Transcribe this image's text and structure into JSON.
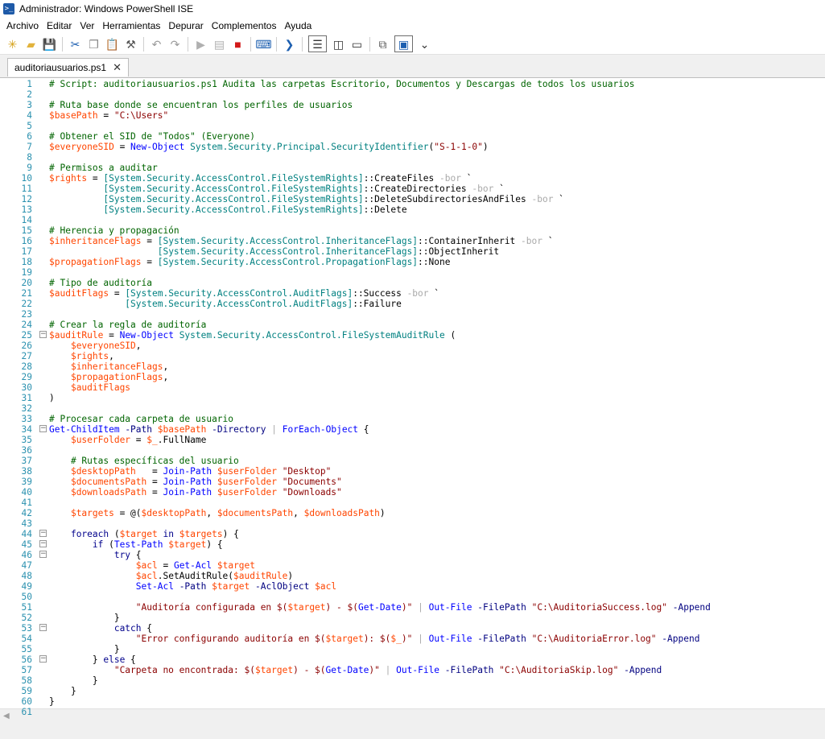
{
  "window": {
    "title": "Administrador: Windows PowerShell ISE"
  },
  "menu": [
    "Archivo",
    "Editar",
    "Ver",
    "Herramientas",
    "Depurar",
    "Complementos",
    "Ayuda"
  ],
  "toolbar": [
    {
      "name": "new-file-icon",
      "glyph": "✳",
      "color": "#d4a017"
    },
    {
      "name": "open-file-icon",
      "glyph": "▰",
      "color": "#e2b33c"
    },
    {
      "name": "save-icon",
      "glyph": "💾",
      "color": "#2a5bb7"
    },
    {
      "sep": true
    },
    {
      "name": "cut-icon",
      "glyph": "✂",
      "color": "#1d5fb0"
    },
    {
      "name": "copy-icon",
      "glyph": "❐",
      "color": "#888888"
    },
    {
      "name": "paste-icon",
      "glyph": "📋",
      "color": "#555555"
    },
    {
      "name": "clear-icon",
      "glyph": "⚒",
      "color": "#555555"
    },
    {
      "sep": true
    },
    {
      "name": "undo-icon",
      "glyph": "↶",
      "color": "#9a9a9a"
    },
    {
      "name": "redo-icon",
      "glyph": "↷",
      "color": "#9a9a9a"
    },
    {
      "sep": true
    },
    {
      "name": "run-icon",
      "glyph": "▶",
      "color": "#b0b0b0"
    },
    {
      "name": "run-selection-icon",
      "glyph": "▤",
      "color": "#b0b0b0"
    },
    {
      "name": "stop-icon",
      "glyph": "■",
      "color": "#d21a1a"
    },
    {
      "sep": true
    },
    {
      "name": "remote-powershell-icon",
      "glyph": "⌨",
      "color": "#1d5fb0"
    },
    {
      "sep": true
    },
    {
      "name": "powershell-console-icon",
      "glyph": "❯",
      "color": "#1d5fb0"
    },
    {
      "sep": true
    },
    {
      "name": "show-script-top-icon",
      "glyph": "☰",
      "color": "#333333",
      "boxed": true
    },
    {
      "name": "show-script-right-icon",
      "glyph": "◫",
      "color": "#333333"
    },
    {
      "name": "show-script-maximized-icon",
      "glyph": "▭",
      "color": "#333333"
    },
    {
      "sep": true
    },
    {
      "name": "show-command-window-icon",
      "glyph": "⧉",
      "color": "#555555"
    },
    {
      "name": "show-command-addon-icon",
      "glyph": "▣",
      "color": "#1d5fb0",
      "boxed": true
    },
    {
      "name": "toolbar-overflow-icon",
      "glyph": "⌄",
      "color": "#333333"
    }
  ],
  "tab": {
    "label": "auditoriausuarios.ps1",
    "close": "✕"
  },
  "colors": {
    "comment": "#006400",
    "variable": "#ff4500",
    "string": "#8b0000",
    "type": "#008080",
    "command": "#0000ff",
    "parameter": "#000080",
    "keyword": "#00008b",
    "line_number": "#2b91af"
  },
  "lines": [
    {
      "n": "1",
      "t": [
        [
          "c",
          "# Script: auditoriausuarios.ps1 Audita las carpetas Escritorio, Documentos y Descargas de todos los usuarios"
        ]
      ]
    },
    {
      "n": "2",
      "t": []
    },
    {
      "n": "3",
      "t": [
        [
          "c",
          "# Ruta base donde se encuentran los perfiles de usuarios"
        ]
      ]
    },
    {
      "n": "4",
      "t": [
        [
          "v",
          "$basePath"
        ],
        [
          "p",
          " = "
        ],
        [
          "s",
          "\"C:\\Users\""
        ]
      ]
    },
    {
      "n": "5",
      "t": []
    },
    {
      "n": "6",
      "t": [
        [
          "c",
          "# Obtener el SID de \"Todos\" (Everyone)"
        ]
      ]
    },
    {
      "n": "7",
      "t": [
        [
          "v",
          "$everyoneSID"
        ],
        [
          "p",
          " = "
        ],
        [
          "cmd",
          "New-Object"
        ],
        [
          "p",
          " "
        ],
        [
          "ty",
          "System.Security.Principal.SecurityIdentifier"
        ],
        [
          "p",
          "("
        ],
        [
          "s",
          "\"S-1-1-0\""
        ],
        [
          "p",
          ")"
        ]
      ]
    },
    {
      "n": "8",
      "t": []
    },
    {
      "n": "9",
      "t": [
        [
          "c",
          "# Permisos a auditar"
        ]
      ]
    },
    {
      "n": "10",
      "t": [
        [
          "v",
          "$rights"
        ],
        [
          "p",
          " = "
        ],
        [
          "ty",
          "[System.Security.AccessControl.FileSystemRights]"
        ],
        [
          "p",
          "::CreateFiles "
        ],
        [
          "o",
          "-bor"
        ],
        [
          "p",
          " `"
        ]
      ]
    },
    {
      "n": "11",
      "t": [
        [
          "p",
          "          "
        ],
        [
          "ty",
          "[System.Security.AccessControl.FileSystemRights]"
        ],
        [
          "p",
          "::CreateDirectories "
        ],
        [
          "o",
          "-bor"
        ],
        [
          "p",
          " `"
        ]
      ]
    },
    {
      "n": "12",
      "t": [
        [
          "p",
          "          "
        ],
        [
          "ty",
          "[System.Security.AccessControl.FileSystemRights]"
        ],
        [
          "p",
          "::DeleteSubdirectoriesAndFiles "
        ],
        [
          "o",
          "-bor"
        ],
        [
          "p",
          " `"
        ]
      ]
    },
    {
      "n": "13",
      "t": [
        [
          "p",
          "          "
        ],
        [
          "ty",
          "[System.Security.AccessControl.FileSystemRights]"
        ],
        [
          "p",
          "::Delete"
        ]
      ]
    },
    {
      "n": "14",
      "t": []
    },
    {
      "n": "15",
      "t": [
        [
          "c",
          "# Herencia y propagación"
        ]
      ]
    },
    {
      "n": "16",
      "t": [
        [
          "v",
          "$inheritanceFlags"
        ],
        [
          "p",
          " = "
        ],
        [
          "ty",
          "[System.Security.AccessControl.InheritanceFlags]"
        ],
        [
          "p",
          "::ContainerInherit "
        ],
        [
          "o",
          "-bor"
        ],
        [
          "p",
          " `"
        ]
      ]
    },
    {
      "n": "17",
      "t": [
        [
          "p",
          "                    "
        ],
        [
          "ty",
          "[System.Security.AccessControl.InheritanceFlags]"
        ],
        [
          "p",
          "::ObjectInherit"
        ]
      ]
    },
    {
      "n": "18",
      "t": [
        [
          "v",
          "$propagationFlags"
        ],
        [
          "p",
          " = "
        ],
        [
          "ty",
          "[System.Security.AccessControl.PropagationFlags]"
        ],
        [
          "p",
          "::None"
        ]
      ]
    },
    {
      "n": "19",
      "t": []
    },
    {
      "n": "20",
      "t": [
        [
          "c",
          "# Tipo de auditoría"
        ]
      ]
    },
    {
      "n": "21",
      "t": [
        [
          "v",
          "$auditFlags"
        ],
        [
          "p",
          " = "
        ],
        [
          "ty",
          "[System.Security.AccessControl.AuditFlags]"
        ],
        [
          "p",
          "::Success "
        ],
        [
          "o",
          "-bor"
        ],
        [
          "p",
          " `"
        ]
      ]
    },
    {
      "n": "22",
      "t": [
        [
          "p",
          "              "
        ],
        [
          "ty",
          "[System.Security.AccessControl.AuditFlags]"
        ],
        [
          "p",
          "::Failure"
        ]
      ]
    },
    {
      "n": "23",
      "t": []
    },
    {
      "n": "24",
      "t": [
        [
          "c",
          "# Crear la regla de auditoría"
        ]
      ]
    },
    {
      "n": "25",
      "f": "⊟",
      "t": [
        [
          "v",
          "$auditRule"
        ],
        [
          "p",
          " = "
        ],
        [
          "cmd",
          "New-Object"
        ],
        [
          "p",
          " "
        ],
        [
          "ty",
          "System.Security.AccessControl.FileSystemAuditRule"
        ],
        [
          "p",
          " ("
        ]
      ]
    },
    {
      "n": "26",
      "t": [
        [
          "p",
          "    "
        ],
        [
          "v",
          "$everyoneSID"
        ],
        [
          "p",
          ","
        ]
      ]
    },
    {
      "n": "27",
      "t": [
        [
          "p",
          "    "
        ],
        [
          "v",
          "$rights"
        ],
        [
          "p",
          ","
        ]
      ]
    },
    {
      "n": "28",
      "t": [
        [
          "p",
          "    "
        ],
        [
          "v",
          "$inheritanceFlags"
        ],
        [
          "p",
          ","
        ]
      ]
    },
    {
      "n": "29",
      "t": [
        [
          "p",
          "    "
        ],
        [
          "v",
          "$propagationFlags"
        ],
        [
          "p",
          ","
        ]
      ]
    },
    {
      "n": "30",
      "t": [
        [
          "p",
          "    "
        ],
        [
          "v",
          "$auditFlags"
        ]
      ]
    },
    {
      "n": "31",
      "t": [
        [
          "p",
          ")"
        ]
      ]
    },
    {
      "n": "32",
      "t": []
    },
    {
      "n": "33",
      "t": [
        [
          "c",
          "# Procesar cada carpeta de usuario"
        ]
      ]
    },
    {
      "n": "34",
      "f": "⊟",
      "t": [
        [
          "cmd",
          "Get-ChildItem"
        ],
        [
          "p",
          " "
        ],
        [
          "pa",
          "-Path"
        ],
        [
          "p",
          " "
        ],
        [
          "v",
          "$basePath"
        ],
        [
          "p",
          " "
        ],
        [
          "pa",
          "-Directory"
        ],
        [
          "p",
          " "
        ],
        [
          "o",
          "|"
        ],
        [
          "p",
          " "
        ],
        [
          "cmd",
          "ForEach-Object"
        ],
        [
          "p",
          " {"
        ]
      ]
    },
    {
      "n": "35",
      "t": [
        [
          "p",
          "    "
        ],
        [
          "v",
          "$userFolder"
        ],
        [
          "p",
          " = "
        ],
        [
          "v",
          "$_"
        ],
        [
          "p",
          ".FullName"
        ]
      ]
    },
    {
      "n": "36",
      "t": []
    },
    {
      "n": "37",
      "t": [
        [
          "p",
          "    "
        ],
        [
          "c",
          "# Rutas específicas del usuario"
        ]
      ]
    },
    {
      "n": "38",
      "t": [
        [
          "p",
          "    "
        ],
        [
          "v",
          "$desktopPath"
        ],
        [
          "p",
          "   = "
        ],
        [
          "cmd",
          "Join-Path"
        ],
        [
          "p",
          " "
        ],
        [
          "v",
          "$userFolder"
        ],
        [
          "p",
          " "
        ],
        [
          "s",
          "\"Desktop\""
        ]
      ]
    },
    {
      "n": "39",
      "t": [
        [
          "p",
          "    "
        ],
        [
          "v",
          "$documentsPath"
        ],
        [
          "p",
          " = "
        ],
        [
          "cmd",
          "Join-Path"
        ],
        [
          "p",
          " "
        ],
        [
          "v",
          "$userFolder"
        ],
        [
          "p",
          " "
        ],
        [
          "s",
          "\"Documents\""
        ]
      ]
    },
    {
      "n": "40",
      "t": [
        [
          "p",
          "    "
        ],
        [
          "v",
          "$downloadsPath"
        ],
        [
          "p",
          " = "
        ],
        [
          "cmd",
          "Join-Path"
        ],
        [
          "p",
          " "
        ],
        [
          "v",
          "$userFolder"
        ],
        [
          "p",
          " "
        ],
        [
          "s",
          "\"Downloads\""
        ]
      ]
    },
    {
      "n": "41",
      "t": []
    },
    {
      "n": "42",
      "t": [
        [
          "p",
          "    "
        ],
        [
          "v",
          "$targets"
        ],
        [
          "p",
          " = @("
        ],
        [
          "v",
          "$desktopPath"
        ],
        [
          "p",
          ", "
        ],
        [
          "v",
          "$documentsPath"
        ],
        [
          "p",
          ", "
        ],
        [
          "v",
          "$downloadsPath"
        ],
        [
          "p",
          ")"
        ]
      ]
    },
    {
      "n": "43",
      "t": []
    },
    {
      "n": "44",
      "f": "⊟",
      "t": [
        [
          "p",
          "    "
        ],
        [
          "k",
          "foreach"
        ],
        [
          "p",
          " ("
        ],
        [
          "v",
          "$target"
        ],
        [
          "p",
          " "
        ],
        [
          "k",
          "in"
        ],
        [
          "p",
          " "
        ],
        [
          "v",
          "$targets"
        ],
        [
          "p",
          ") {"
        ]
      ]
    },
    {
      "n": "45",
      "f": "⊟",
      "t": [
        [
          "p",
          "        "
        ],
        [
          "k",
          "if"
        ],
        [
          "p",
          " ("
        ],
        [
          "cmd",
          "Test-Path"
        ],
        [
          "p",
          " "
        ],
        [
          "v",
          "$target"
        ],
        [
          "p",
          ") {"
        ]
      ]
    },
    {
      "n": "46",
      "f": "⊟",
      "t": [
        [
          "p",
          "            "
        ],
        [
          "k",
          "try"
        ],
        [
          "p",
          " {"
        ]
      ]
    },
    {
      "n": "47",
      "t": [
        [
          "p",
          "                "
        ],
        [
          "v",
          "$acl"
        ],
        [
          "p",
          " = "
        ],
        [
          "cmd",
          "Get-Acl"
        ],
        [
          "p",
          " "
        ],
        [
          "v",
          "$target"
        ]
      ]
    },
    {
      "n": "48",
      "t": [
        [
          "p",
          "                "
        ],
        [
          "v",
          "$acl"
        ],
        [
          "p",
          ".SetAuditRule("
        ],
        [
          "v",
          "$auditRule"
        ],
        [
          "p",
          ")"
        ]
      ]
    },
    {
      "n": "49",
      "t": [
        [
          "p",
          "                "
        ],
        [
          "cmd",
          "Set-Acl"
        ],
        [
          "p",
          " "
        ],
        [
          "pa",
          "-Path"
        ],
        [
          "p",
          " "
        ],
        [
          "v",
          "$target"
        ],
        [
          "p",
          " "
        ],
        [
          "pa",
          "-AclObject"
        ],
        [
          "p",
          " "
        ],
        [
          "v",
          "$acl"
        ]
      ]
    },
    {
      "n": "50",
      "t": []
    },
    {
      "n": "51",
      "t": [
        [
          "p",
          "                "
        ],
        [
          "s",
          "\"Auditoría configurada en $("
        ],
        [
          "v",
          "$target"
        ],
        [
          "s",
          ") - $("
        ],
        [
          "cmd",
          "Get-Date"
        ],
        [
          "s",
          ")\""
        ],
        [
          "p",
          " "
        ],
        [
          "o",
          "|"
        ],
        [
          "p",
          " "
        ],
        [
          "cmd",
          "Out-File"
        ],
        [
          "p",
          " "
        ],
        [
          "pa",
          "-FilePath"
        ],
        [
          "p",
          " "
        ],
        [
          "s",
          "\"C:\\AuditoriaSuccess.log\""
        ],
        [
          "p",
          " "
        ],
        [
          "pa",
          "-Append"
        ]
      ]
    },
    {
      "n": "52",
      "t": [
        [
          "p",
          "            }"
        ]
      ]
    },
    {
      "n": "53",
      "f": "⊟",
      "t": [
        [
          "p",
          "            "
        ],
        [
          "k",
          "catch"
        ],
        [
          "p",
          " {"
        ]
      ]
    },
    {
      "n": "54",
      "t": [
        [
          "p",
          "                "
        ],
        [
          "s",
          "\"Error configurando auditoría en $("
        ],
        [
          "v",
          "$target"
        ],
        [
          "s",
          "): $("
        ],
        [
          "v",
          "$_"
        ],
        [
          "s",
          ")\""
        ],
        [
          "p",
          " "
        ],
        [
          "o",
          "|"
        ],
        [
          "p",
          " "
        ],
        [
          "cmd",
          "Out-File"
        ],
        [
          "p",
          " "
        ],
        [
          "pa",
          "-FilePath"
        ],
        [
          "p",
          " "
        ],
        [
          "s",
          "\"C:\\AuditoriaError.log\""
        ],
        [
          "p",
          " "
        ],
        [
          "pa",
          "-Append"
        ]
      ]
    },
    {
      "n": "55",
      "t": [
        [
          "p",
          "            }"
        ]
      ]
    },
    {
      "n": "56",
      "f": "⊟",
      "t": [
        [
          "p",
          "        } "
        ],
        [
          "k",
          "else"
        ],
        [
          "p",
          " {"
        ]
      ]
    },
    {
      "n": "57",
      "t": [
        [
          "p",
          "            "
        ],
        [
          "s",
          "\"Carpeta no encontrada: $("
        ],
        [
          "v",
          "$target"
        ],
        [
          "s",
          ") - $("
        ],
        [
          "cmd",
          "Get-Date"
        ],
        [
          "s",
          ")\""
        ],
        [
          "p",
          " "
        ],
        [
          "o",
          "|"
        ],
        [
          "p",
          " "
        ],
        [
          "cmd",
          "Out-File"
        ],
        [
          "p",
          " "
        ],
        [
          "pa",
          "-FilePath"
        ],
        [
          "p",
          " "
        ],
        [
          "s",
          "\"C:\\AuditoriaSkip.log\""
        ],
        [
          "p",
          " "
        ],
        [
          "pa",
          "-Append"
        ]
      ]
    },
    {
      "n": "58",
      "t": [
        [
          "p",
          "        }"
        ]
      ]
    },
    {
      "n": "59",
      "t": [
        [
          "p",
          "    }"
        ]
      ]
    },
    {
      "n": "60",
      "t": [
        [
          "p",
          "}"
        ]
      ]
    },
    {
      "n": "61",
      "t": []
    }
  ]
}
